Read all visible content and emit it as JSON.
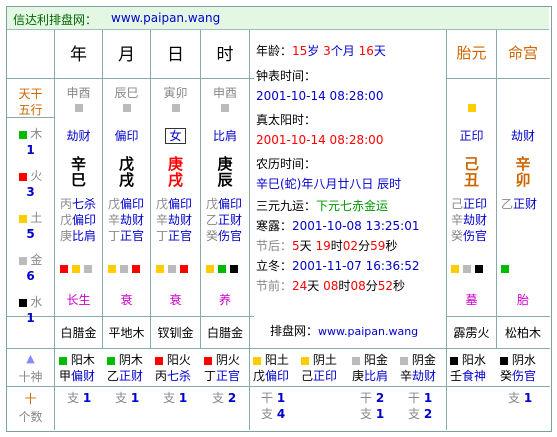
{
  "banner": {
    "title": "信达利排盘网：",
    "url": "www.paipan.wang"
  },
  "left_labels": {
    "tiangan": "天干",
    "wuxing": "五行"
  },
  "elements": [
    {
      "name": "木",
      "count": "1",
      "color": "#00bb00"
    },
    {
      "name": "火",
      "count": "3",
      "color": "#ff0000"
    },
    {
      "name": "土",
      "count": "5",
      "color": "#ffcc00"
    },
    {
      "name": "金",
      "count": "6",
      "color": "#bbbbbb"
    },
    {
      "name": "水",
      "count": "1",
      "color": "#000000"
    }
  ],
  "pillars": [
    {
      "header": "年",
      "ganzhi": "申酉",
      "sq": "#bbbbbb",
      "shishen": "劫财",
      "gan": "辛",
      "zhi": "巳",
      "gan_color": "#000000",
      "zhi_color": "#000000",
      "hidden": [
        [
          "丙",
          "七杀"
        ],
        [
          "戊",
          "偏印"
        ],
        [
          "庚",
          "比肩"
        ]
      ],
      "sqs": [
        "#ff0000",
        "#ffcc00",
        "#bbbbbb"
      ],
      "state": "长生",
      "nayin": "白腊金"
    },
    {
      "header": "月",
      "ganzhi": "辰巳",
      "sq": "#bbbbbb",
      "shishen": "偏印",
      "gan": "戊",
      "zhi": "戌",
      "gan_color": "#000000",
      "zhi_color": "#000000",
      "hidden": [
        [
          "戊",
          "偏印"
        ],
        [
          "辛",
          "劫财"
        ],
        [
          "丁",
          "正官"
        ]
      ],
      "sqs": [
        "#ffcc00",
        "#bbbbbb",
        "#ff0000"
      ],
      "state": "衰",
      "nayin": "平地木"
    },
    {
      "header": "日",
      "ganzhi": "寅卯",
      "sq": "#bbbbbb",
      "shishen": "女",
      "gan": "庚",
      "zhi": "戌",
      "gan_color": "#ff0000",
      "zhi_color": "#ff0000",
      "hidden": [
        [
          "戊",
          "偏印"
        ],
        [
          "辛",
          "劫财"
        ],
        [
          "丁",
          "正官"
        ]
      ],
      "sqs": [
        "#ffcc00",
        "#bbbbbb",
        "#ff0000"
      ],
      "state": "衰",
      "nayin": "钗钏金"
    },
    {
      "header": "时",
      "ganzhi": "申酉",
      "sq": "#bbbbbb",
      "shishen": "比肩",
      "gan": "庚",
      "zhi": "辰",
      "gan_color": "#000000",
      "zhi_color": "#000000",
      "hidden": [
        [
          "戊",
          "偏印"
        ],
        [
          "乙",
          "正财"
        ],
        [
          "癸",
          "伤官"
        ]
      ],
      "sqs": [
        "#ffcc00",
        "#00bb00",
        "#000000"
      ],
      "state": "养",
      "nayin": "白腊金"
    }
  ],
  "extra_pillars": [
    {
      "header": "胎元",
      "sq": "#ffcc00",
      "shishen": "正印",
      "gan": "己",
      "zhi": "丑",
      "hidden": [
        [
          "己",
          "正印"
        ],
        [
          "辛",
          "劫财"
        ],
        [
          "癸",
          "伤官"
        ]
      ],
      "sqs": [
        "#ffcc00",
        "#bbbbbb",
        "#000000"
      ],
      "state": "墓",
      "nayin": "霹雳火",
      "ts_sq": "#ffcc00",
      "ts1": "阳土",
      "ts2": "戊",
      "ts3": "偏印",
      "zhi_label": "支",
      "zhi_count": "1",
      "gan_label": "干",
      "gan_count": "1"
    },
    {
      "header": "命宫",
      "sq": "",
      "shishen": "劫财",
      "gan": "辛",
      "zhi": "卯",
      "hidden": [
        [
          "乙",
          "正财"
        ]
      ],
      "sqs": [
        "#00bb00"
      ],
      "state": "胎",
      "nayin": "松柏木",
      "ts_sq": "#000000",
      "ts1": "阴水",
      "ts2": "癸",
      "ts3": "伤官",
      "zhi_label": "支",
      "zhi_count": "1",
      "gan_label": "干",
      "gan_count": "1"
    }
  ],
  "info": {
    "age_label": "年龄：",
    "age_years": "15",
    "age_y_unit": "岁",
    "age_months": "3",
    "age_m_unit": "个月",
    "age_days": "16",
    "age_d_unit": "天",
    "clock_label": "钟表时间：",
    "clock_value": "2001-10-14 08:28:00",
    "solar_label": "真太阳时：",
    "solar_value": "2001-10-14 08:28:00",
    "lunar_label": "农历时间：",
    "lunar_value": "辛巳(蛇)年八月廿八日 辰时",
    "yun_label": "三元九运：",
    "yun_value": "下元七赤金运",
    "jq1_label": "寒露：",
    "jq1_value": "2001-10-08 13:25:01",
    "before_label": "节后：",
    "before_d": "5",
    "before_d_u": "天",
    "before_h": "19",
    "before_h_u": "时",
    "before_m": "02",
    "before_m_u": "分",
    "before_s": "59",
    "before_s_u": "秒",
    "jq2_label": "立冬：",
    "jq2_value": "2001-11-07 16:36:52",
    "after_label": "节前：",
    "after_d": "24",
    "after_d_u": "天",
    "after_h": "08",
    "after_h_u": "时",
    "after_m": "08",
    "after_m_u": "分",
    "after_s": "52",
    "after_s_u": "秒",
    "site_label": "排盘网：",
    "site_url": "www.paipan.wang"
  },
  "bottom": {
    "shishen_label": "十神",
    "geshu_label": "个数",
    "top_label": "十",
    "cols": [
      {
        "sq": "#00bb00",
        "yy": "阳木",
        "g": "甲",
        "ss": "偏财",
        "zl": "支",
        "zc": "1",
        "gl": "",
        "gc": ""
      },
      {
        "sq": "#00bb00",
        "yy": "阴木",
        "g": "乙",
        "ss": "正财",
        "zl": "支",
        "zc": "1",
        "gl": "",
        "gc": ""
      },
      {
        "sq": "#ff0000",
        "yy": "阳火",
        "g": "丙",
        "ss": "七杀",
        "zl": "支",
        "zc": "1",
        "gl": "",
        "gc": ""
      },
      {
        "sq": "#ff0000",
        "yy": "阴火",
        "g": "丁",
        "ss": "正官",
        "zl": "支",
        "zc": "2",
        "gl": "",
        "gc": ""
      },
      {
        "sq": "#ffcc00",
        "yy": "阳土",
        "g": "戊",
        "ss": "偏印",
        "zl": "支",
        "zc": "4",
        "gl": "干",
        "gc": "1"
      },
      {
        "sq": "#ffcc00",
        "yy": "阴土",
        "g": "己",
        "ss": "正印",
        "zl": "",
        "zc": "",
        "gl": "",
        "gc": ""
      },
      {
        "sq": "#bbbbbb",
        "yy": "阳金",
        "g": "庚",
        "ss": "比肩",
        "zl": "支",
        "zc": "1",
        "gl": "干",
        "gc": "2"
      },
      {
        "sq": "#bbbbbb",
        "yy": "阴金",
        "g": "辛",
        "ss": "劫财",
        "zl": "支",
        "zc": "2",
        "gl": "干",
        "gc": "1"
      },
      {
        "sq": "#000000",
        "yy": "阳水",
        "g": "壬",
        "ss": "食神",
        "zl": "",
        "zc": "",
        "gl": "",
        "gc": ""
      },
      {
        "sq": "#000000",
        "yy": "阴水",
        "g": "癸",
        "ss": "伤官",
        "zl": "支",
        "zc": "1",
        "gl": "",
        "gc": ""
      }
    ]
  }
}
